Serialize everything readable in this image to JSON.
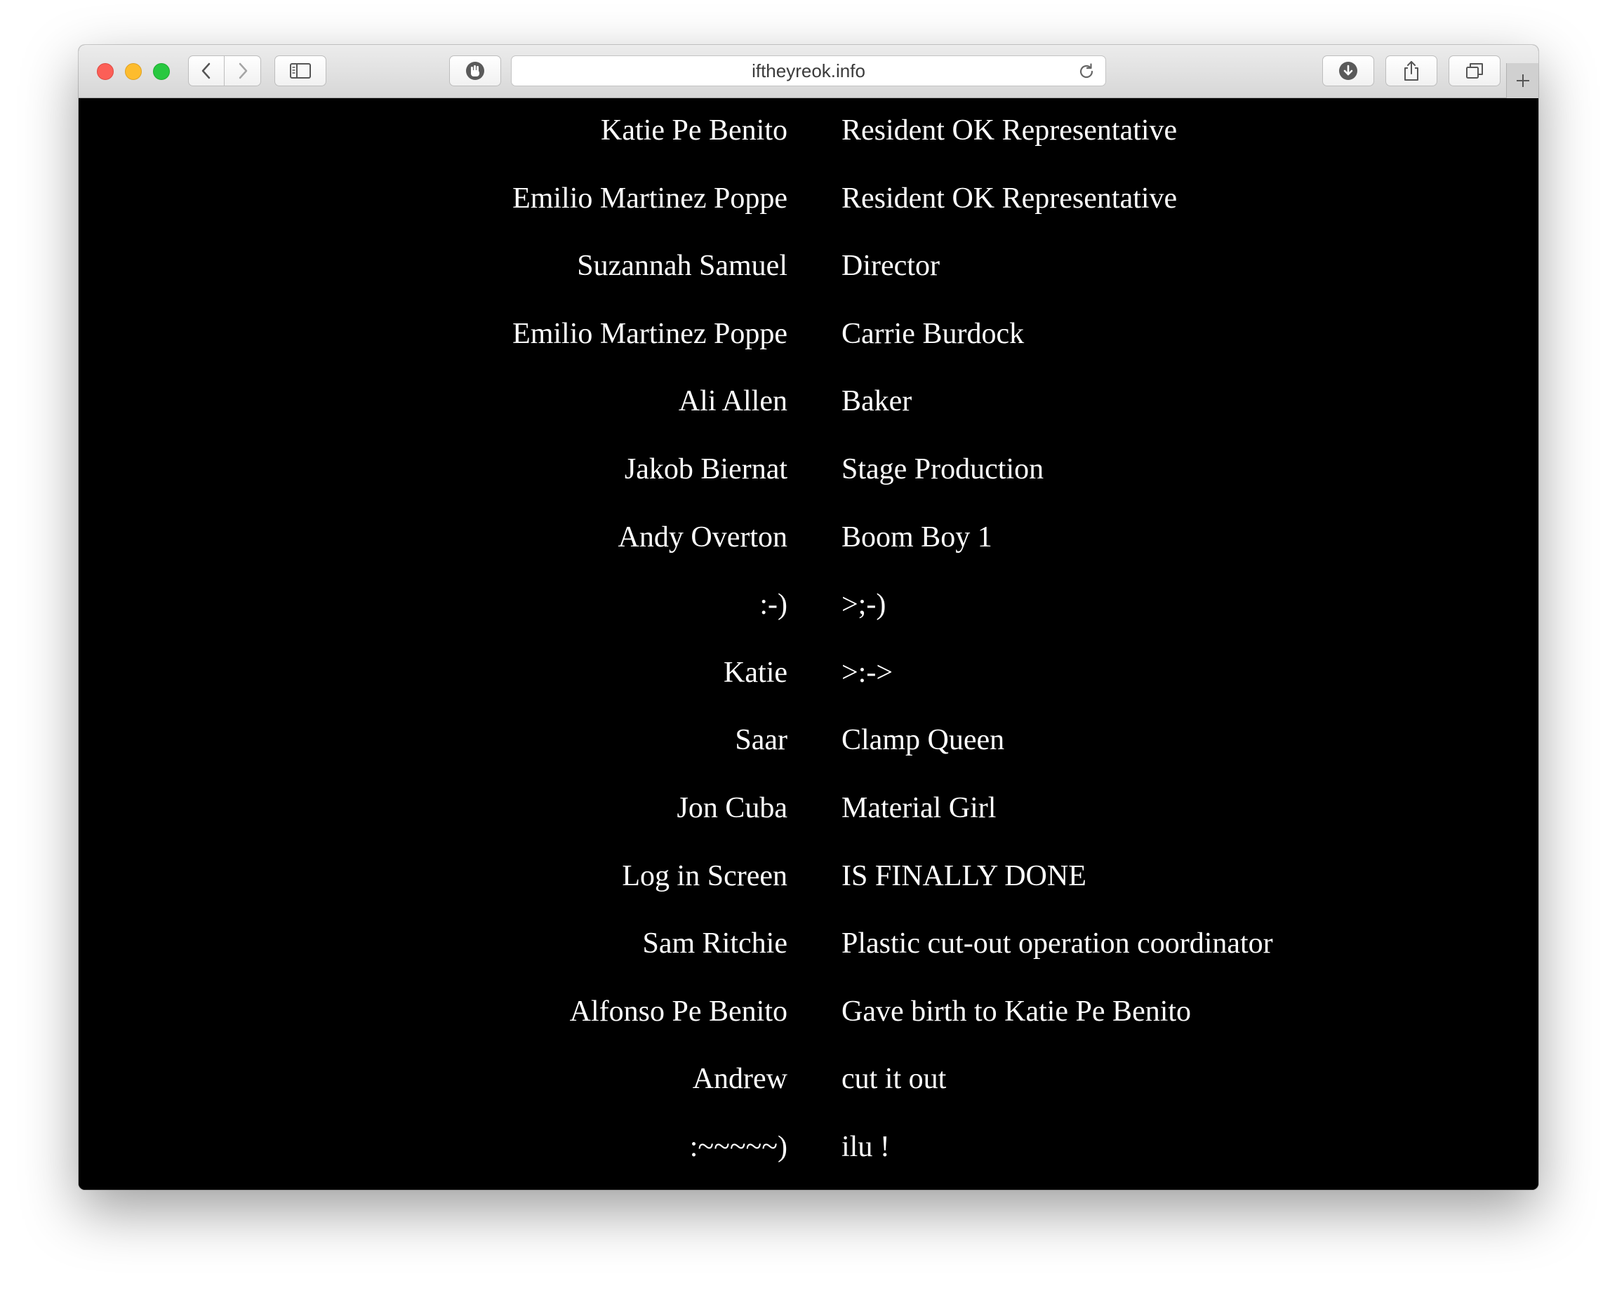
{
  "browser": {
    "url": "iftheyreok.info"
  },
  "credits": [
    {
      "name": "Katie Pe Benito",
      "role": "Resident OK Representative"
    },
    {
      "name": "Emilio Martinez Poppe",
      "role": "Resident OK Representative"
    },
    {
      "name": "Suzannah Samuel",
      "role": "Director"
    },
    {
      "name": "Emilio Martinez Poppe",
      "role": "Carrie Burdock"
    },
    {
      "name": "Ali Allen",
      "role": "Baker"
    },
    {
      "name": "Jakob Biernat",
      "role": "Stage Production"
    },
    {
      "name": "Andy Overton",
      "role": "Boom Boy 1"
    },
    {
      "name": ":-)",
      "role": ">;-)"
    },
    {
      "name": "Katie",
      "role": ">:->"
    },
    {
      "name": "Saar",
      "role": "Clamp Queen"
    },
    {
      "name": "Jon Cuba",
      "role": "Material Girl"
    },
    {
      "name": "Log in Screen",
      "role": "IS FINALLY DONE"
    },
    {
      "name": "Sam Ritchie",
      "role": "Plastic cut-out operation coordinator"
    },
    {
      "name": "Alfonso Pe Benito",
      "role": "Gave birth to Katie Pe Benito"
    },
    {
      "name": "Andrew",
      "role": "cut it out"
    },
    {
      "name": ":~~~~~)",
      "role": "ilu !"
    }
  ],
  "colors": {
    "page_background": "#000000",
    "text": "#ffffff"
  }
}
